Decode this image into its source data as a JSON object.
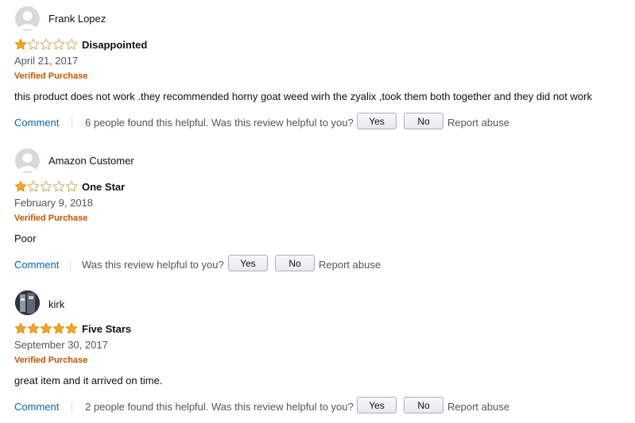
{
  "reviews": [
    {
      "author": "Frank Lopez",
      "avatar_icon": "default-avatar-icon",
      "rating": 1,
      "rating_max": 5,
      "title": "Disappointed",
      "date": "April 21, 2017",
      "verified": "Verified Purchase",
      "body": "this product does not work .they recommended horny goat weed wirh the zyalix ,took them both together and they did not work",
      "comment_label": "Comment",
      "helpful_text": "6 people found this helpful. Was this review helpful to you?",
      "yes_label": "Yes",
      "no_label": "No",
      "report_label": "Report abuse"
    },
    {
      "author": "Amazon Customer",
      "avatar_icon": "default-avatar-icon",
      "rating": 1,
      "rating_max": 5,
      "title": "One Star",
      "date": "February 9, 2018",
      "verified": "Verified Purchase",
      "body": "Poor",
      "comment_label": "Comment",
      "helpful_text": "Was this review helpful to you?",
      "yes_label": "Yes",
      "no_label": "No",
      "report_label": "Report abuse"
    },
    {
      "author": "kirk",
      "avatar_icon": "photo-avatar-icon",
      "rating": 5,
      "rating_max": 5,
      "title": "Five Stars",
      "date": "September 30, 2017",
      "verified": "Verified Purchase",
      "body": "great item and it arrived on time.",
      "comment_label": "Comment",
      "helpful_text": "2 people found this helpful. Was this review helpful to you?",
      "yes_label": "Yes",
      "no_label": "No",
      "report_label": "Report abuse"
    }
  ],
  "colors": {
    "star_filled": "#ffa41c",
    "star_empty_stroke": "#c9a45a",
    "link": "#0066c0",
    "verified": "#c45500"
  }
}
